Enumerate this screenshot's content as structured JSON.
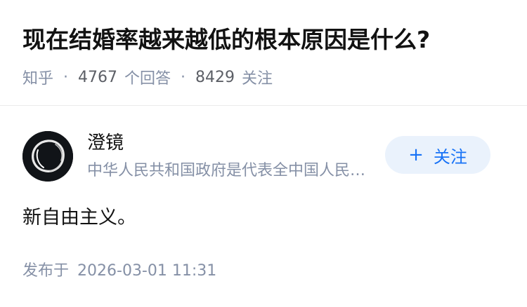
{
  "question": {
    "title": "现在结婚率越来越低的根本原因是什么?",
    "source": "知乎",
    "separator": "·",
    "answer_count": "4767",
    "answer_label": "个回答",
    "follow_count": "8429",
    "follow_label": "关注"
  },
  "answer": {
    "author": {
      "name": "澄镜",
      "bio": "中华人民共和国政府是代表全中国人民的唯一合法政府",
      "avatar_icon": "ink-circle-avatar"
    },
    "follow_button": {
      "plus": "+",
      "label": "关注"
    },
    "content": "新自由主义。",
    "published_label": "发布于",
    "published_time": "2026-03-01 11:31"
  },
  "colors": {
    "title": "#121212",
    "meta": "#8590a6",
    "follow_bg": "#eaf2fc",
    "follow_text": "#1772f6",
    "divider": "#ebebeb"
  }
}
